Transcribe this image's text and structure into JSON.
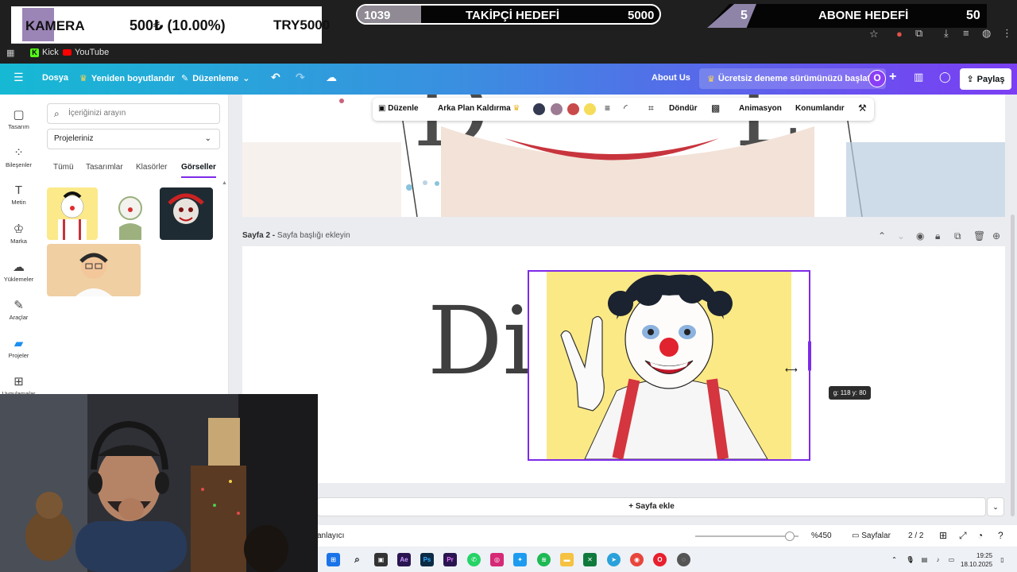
{
  "overlay": {
    "camera_label": "KAMERA",
    "camera_amount": "500₺ (10.00%)",
    "camera_target": "TRY5000",
    "follower_goal": {
      "current": "1039",
      "label": "TAKİPÇİ HEDEFİ",
      "target": "5000",
      "progress": 0.21
    },
    "sub_goal": {
      "current": "5",
      "label": "ABONE HEDEFİ",
      "target": "50",
      "progress": 0.1
    }
  },
  "bookmarks": [
    {
      "label": "Kick",
      "icon": "kick-icon"
    },
    {
      "label": "YouTube",
      "icon": "youtube-icon"
    }
  ],
  "topbar": {
    "file": "Dosya",
    "resize": "Yeniden boyutlandır",
    "editing": "Düzenleme",
    "about": "About Us",
    "trial": "Ücretsiz deneme sürümünüzü başlatın",
    "avatar": "O",
    "share": "Paylaş"
  },
  "rail": [
    {
      "label": "Tasarım",
      "icon": "design-icon"
    },
    {
      "label": "Bileşenler",
      "icon": "elements-icon"
    },
    {
      "label": "Metin",
      "icon": "text-icon"
    },
    {
      "label": "Marka",
      "icon": "brand-icon"
    },
    {
      "label": "Yüklemeler",
      "icon": "upload-icon"
    },
    {
      "label": "Araçlar",
      "icon": "draw-icon"
    },
    {
      "label": "Projeler",
      "icon": "folder-icon"
    },
    {
      "label": "Uygulamalar",
      "icon": "apps-icon"
    }
  ],
  "panel": {
    "search_placeholder": "İçeriğinizi arayın",
    "select_value": "Projeleriniz",
    "tabs": [
      "Tümü",
      "Tasarımlar",
      "Klasörler",
      "Görseller"
    ],
    "active_tab": "Görseller"
  },
  "toolbar": {
    "edit": "Düzenle",
    "bg_remove": "Arka Plan Kaldırma",
    "swatches": [
      "#343a52",
      "#9e7b94",
      "#c94a4a",
      "#f5dc5a"
    ],
    "rotate": "Döndür",
    "animate": "Animasyon",
    "position": "Konumlandır"
  },
  "page2": {
    "title": "Sayfa 2 -",
    "placeholder": "Sayfa başlığı ekleyin",
    "text": "Dis",
    "dim_tip": "g: 118 y: 80"
  },
  "add_page": "Sayfa ekle",
  "bottom": {
    "notes": "anlayıcı",
    "zoom": "%450",
    "pages_label": "Sayfalar",
    "page_count": "2 / 2"
  },
  "clock": {
    "time": "19:25",
    "date": "18.10.2025"
  },
  "colors": {
    "accent": "#7d2ae8",
    "teal": "#16b9d4"
  }
}
